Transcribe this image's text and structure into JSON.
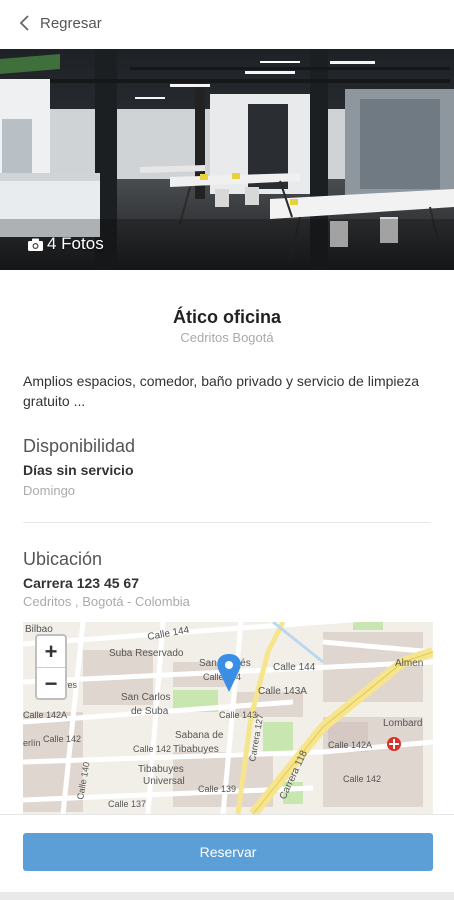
{
  "header": {
    "back_label": "Regresar"
  },
  "hero": {
    "photos_label": "4 Fotos"
  },
  "listing": {
    "title": "Ático oficina",
    "location": "Cedritos Bogotá",
    "description": "Amplios espacios, comedor, baño privado y servicio de limpieza gratuito ..."
  },
  "availability": {
    "heading": "Disponibilidad",
    "label": "Días sin servicio",
    "value": "Domingo"
  },
  "location_section": {
    "heading": "Ubicación",
    "address": "Carrera 123 45 67",
    "area": "Cedritos , Bogotá - Colombia"
  },
  "map": {
    "zoom_in": "+",
    "zoom_out": "−",
    "labels": {
      "bilbao": "Bilbao",
      "calle144": "Calle 144",
      "suba_reservado": "Suba Reservado",
      "san_andres": "San Andrés",
      "calle144b": "Calle 144",
      "almendros": "Almen",
      "calle143": "Calle 143",
      "calle143a": "Calle 143A",
      "san_carlos": "San Carlos",
      "de_suba": "de Suba",
      "lombardia": "Lombard",
      "calle142a": "Calle 142A",
      "calle142a_b": "Calle 142A",
      "calle142": "Calle 142",
      "sabana": "Sabana de",
      "tibabuyes": "Tibabuyes",
      "calle142b": "Calle 142",
      "tibabuyes_u": "Tibabuyes",
      "universal": "Universal",
      "carrera118": "Carrera 118",
      "calle139": "Calle 139",
      "calle137": "Calle 137",
      "calle140": "Calle 140",
      "calle142c": "Calle 142",
      "berlin": "erlín",
      "ayes": "yes",
      "calle144c": "Calle 144",
      "carrera127": "Carrera 127"
    },
    "colors": {
      "main_road": "#f6e58d",
      "park": "#c8e6b0",
      "pin": "#3a8ee6",
      "hospital": "#d9302c"
    }
  },
  "actions": {
    "reserve_label": "Reservar"
  },
  "colors": {
    "accent": "#5b9fd6"
  }
}
